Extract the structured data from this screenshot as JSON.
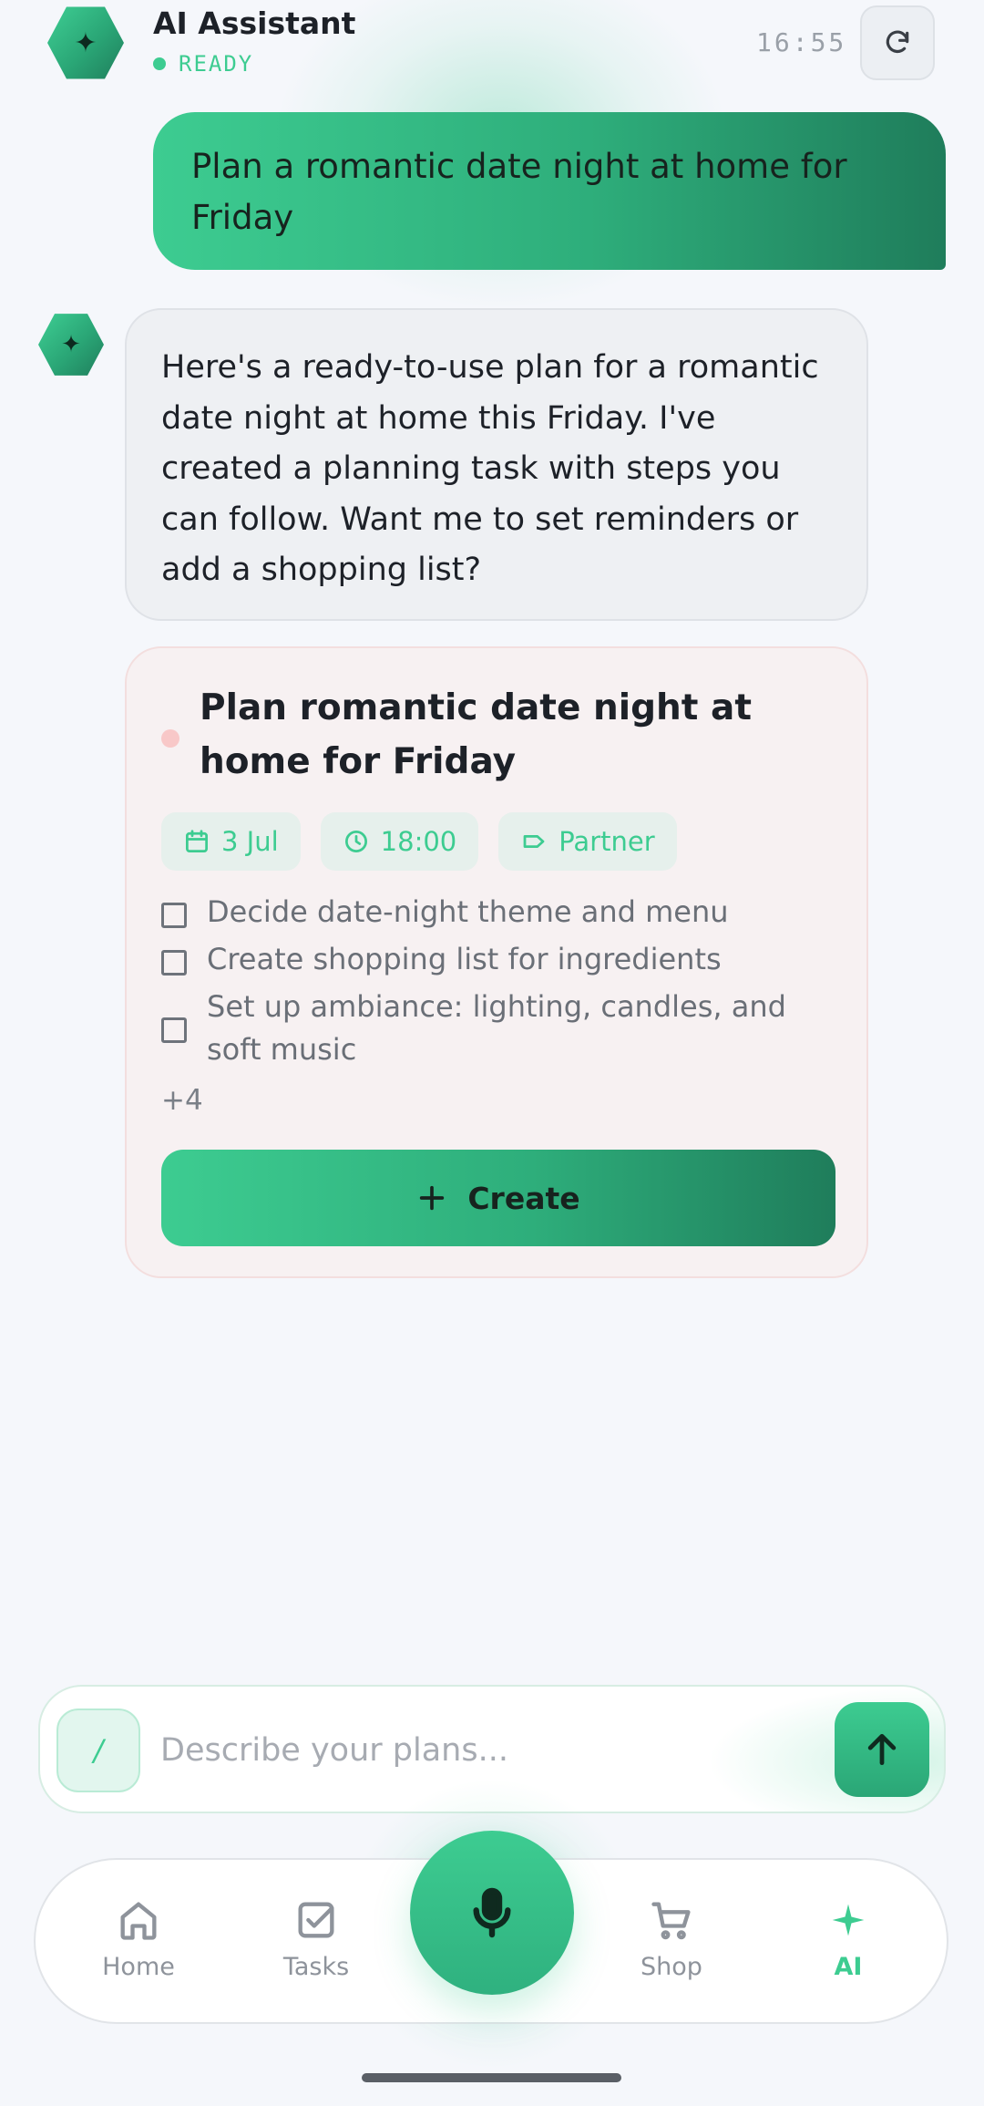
{
  "header": {
    "title": "AI Assistant",
    "status": "READY",
    "time": "16:55",
    "refresh_icon": "refresh-icon"
  },
  "conversation": {
    "user_message": "Plan a romantic date night at home for Friday",
    "assistant_message": "Here's a ready-to-use plan for a romantic date night at home this Friday. I've created a planning task with steps you can follow. Want me to set reminders or add a shopping list?"
  },
  "task_card": {
    "title": "Plan romantic date night at home for Friday",
    "date": "3 Jul",
    "time": "18:00",
    "tag": "Partner",
    "checklist": [
      "Decide date-night theme and menu",
      "Create shopping list for ingredients",
      "Set up ambiance: lighting, candles, and soft music"
    ],
    "more_count": "+4",
    "create_label": "Create"
  },
  "composer": {
    "slash_label": "/",
    "placeholder": "Describe your plans...",
    "value": ""
  },
  "nav": {
    "items": [
      {
        "label": "Home",
        "icon": "home-icon"
      },
      {
        "label": "Tasks",
        "icon": "tasks-icon"
      },
      {
        "label": "Shop",
        "icon": "cart-icon"
      },
      {
        "label": "AI",
        "icon": "sparkle-icon"
      }
    ],
    "active": "AI",
    "mic_icon": "microphone-icon"
  },
  "colors": {
    "accent": "#3dcc91",
    "accent_dark": "#1f7d5b",
    "background": "#f5f7fb",
    "priority_dot": "#f8c8c8"
  }
}
